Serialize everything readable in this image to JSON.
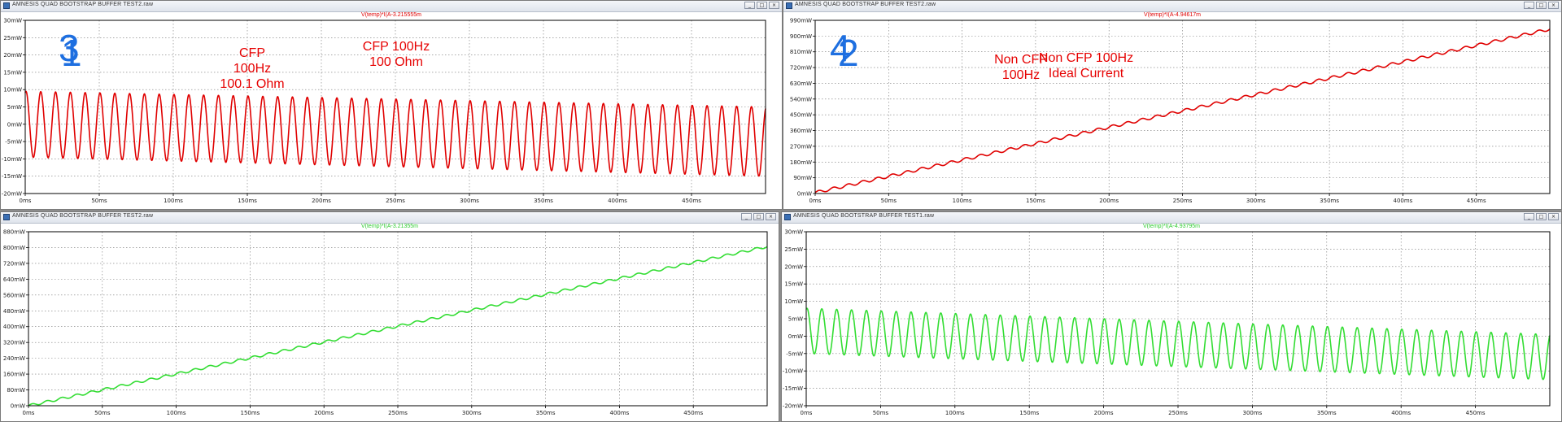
{
  "colors": {
    "red": "#e00000",
    "green": "#33dd33"
  },
  "windows": [
    {
      "title": "AMNESIS QUAD BOOTSTRAP BUFFER TEST2.raw",
      "trace_label": "V(temp)*I(A-3.215555m",
      "trace_color": "#e00000",
      "number": "1",
      "annotation": "CFP 100Hz\n100 Ohm",
      "controls": [
        "_",
        "□",
        "×"
      ],
      "chart_data": {
        "type": "line",
        "xlabel": "",
        "ylabel": "",
        "x_unit": "ms",
        "y_unit": "W",
        "xlim": [
          0,
          500
        ],
        "ylim": [
          -20,
          30
        ],
        "grid": true,
        "xticks": [
          "0ms",
          "50ms",
          "100ms",
          "150ms",
          "200ms",
          "250ms",
          "300ms",
          "350ms",
          "400ms",
          "450ms"
        ],
        "yticks": [
          "-20mW",
          "-15mW",
          "-10mW",
          "-5mW",
          "0mW",
          "5mW",
          "10mW",
          "15mW",
          "20mW",
          "25mW",
          "30mW"
        ],
        "series": [
          {
            "color": "#e00000",
            "freq_hz": 100,
            "offset_start": 0,
            "offset_end": -5,
            "amp_start": 9.5,
            "amp_end": 10,
            "trend": 0,
            "phase": 0.2
          }
        ]
      }
    },
    {
      "title": "AMNESIS QUAD BOOTSTRAP BUFFER TEST2.raw",
      "trace_label": "V(temp)*I(A-4.94617m",
      "trace_color": "#e00000",
      "number": "2",
      "annotation": "Non CFP\n100Hz",
      "controls": [
        "_",
        "□",
        "×"
      ],
      "chart_data": {
        "type": "line",
        "xlabel": "",
        "ylabel": "",
        "x_unit": "ms",
        "y_unit": "W",
        "xlim": [
          0,
          500
        ],
        "ylim": [
          0,
          990
        ],
        "grid": true,
        "xticks": [
          "0ms",
          "50ms",
          "100ms",
          "150ms",
          "200ms",
          "250ms",
          "300ms",
          "350ms",
          "400ms",
          "450ms"
        ],
        "yticks": [
          "0mW",
          "90mW",
          "180mW",
          "270mW",
          "360mW",
          "450mW",
          "540mW",
          "630mW",
          "720mW",
          "810mW",
          "900mW",
          "990mW"
        ],
        "series": [
          {
            "color": "#e00000",
            "freq_hz": 100,
            "offset_start": 5,
            "offset_end": 940,
            "amp_start": 8,
            "amp_end": 8,
            "trend": 1,
            "phase": 0
          }
        ]
      }
    },
    {
      "title": "AMNESIS QUAD BOOTSTRAP BUFFER TEST2.raw",
      "trace_label": "V(temp)*I(A-3.21355m",
      "trace_color": "#2ecc2e",
      "number": "3",
      "annotation": "CFP\n100Hz\n100.1 Ohm",
      "controls": [
        "_",
        "□",
        "×"
      ],
      "chart_data": {
        "type": "line",
        "xlabel": "",
        "ylabel": "",
        "x_unit": "ms",
        "y_unit": "W",
        "xlim": [
          0,
          500
        ],
        "ylim": [
          0,
          880
        ],
        "grid": true,
        "xticks": [
          "0ms",
          "50ms",
          "100ms",
          "150ms",
          "200ms",
          "250ms",
          "300ms",
          "350ms",
          "400ms",
          "450ms"
        ],
        "yticks": [
          "0mW",
          "80mW",
          "160mW",
          "240mW",
          "320mW",
          "400mW",
          "480mW",
          "560mW",
          "640mW",
          "720mW",
          "800mW",
          "880mW"
        ],
        "series": [
          {
            "color": "#33dd33",
            "freq_hz": 100,
            "offset_start": 0,
            "offset_end": 805,
            "amp_start": 6,
            "amp_end": 6,
            "trend": 1,
            "phase": 0
          }
        ]
      }
    },
    {
      "title": "AMNESIS QUAD BOOTSTRAP BUFFER TEST1.raw",
      "trace_label": "V(temp)*I(A-4.93795m",
      "trace_color": "#2ecc2e",
      "number": "4",
      "annotation": "Non CFP 100Hz\nIdeal Current",
      "controls": [
        "_",
        "□",
        "×"
      ],
      "chart_data": {
        "type": "line",
        "xlabel": "",
        "ylabel": "",
        "x_unit": "ms",
        "y_unit": "W",
        "xlim": [
          0,
          500
        ],
        "ylim": [
          -20,
          30
        ],
        "grid": true,
        "xticks": [
          "0ms",
          "50ms",
          "100ms",
          "150ms",
          "200ms",
          "250ms",
          "300ms",
          "350ms",
          "400ms",
          "450ms"
        ],
        "yticks": [
          "-20mW",
          "-15mW",
          "-10mW",
          "-5mW",
          "0mW",
          "5mW",
          "10mW",
          "15mW",
          "20mW",
          "25mW",
          "30mW"
        ],
        "series": [
          {
            "color": "#33dd33",
            "freq_hz": 100,
            "offset_start": 1.5,
            "offset_end": -6,
            "amp_start": 6.5,
            "amp_end": 6.5,
            "trend": 0,
            "phase": 0.2
          }
        ]
      }
    }
  ]
}
